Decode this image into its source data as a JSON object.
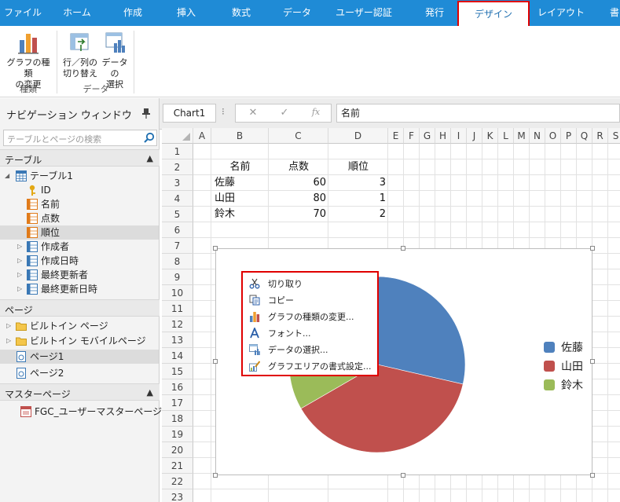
{
  "ribbon": {
    "tabs": [
      {
        "label": "ファイル",
        "active": false
      },
      {
        "label": "ホーム",
        "active": false
      },
      {
        "label": "作成",
        "active": false
      },
      {
        "label": "挿入",
        "active": false
      },
      {
        "label": "数式",
        "active": false
      },
      {
        "label": "データ",
        "active": false
      },
      {
        "label": "ユーザー認証",
        "active": false
      },
      {
        "label": "発行",
        "active": false
      },
      {
        "label": "デザイン",
        "active": true
      },
      {
        "label": "レイアウト",
        "active": false
      },
      {
        "label": "書",
        "active": false
      }
    ],
    "groups": [
      {
        "label": "種類",
        "buttons": [
          {
            "line1": "グラフの種類",
            "line2": "の変更",
            "icon": "chart-type-icon"
          }
        ]
      },
      {
        "label": "データ",
        "buttons": [
          {
            "line1": "行／列の",
            "line2": "切り替え",
            "icon": "switch-row-column-icon"
          },
          {
            "line1": "データの",
            "line2": "選択",
            "icon": "select-data-icon"
          }
        ]
      }
    ],
    "accent": "#1f8bd6",
    "highlight": "#e00000"
  },
  "nav": {
    "title": "ナビゲーション ウィンドウ",
    "search_placeholder": "テーブルとページの検索",
    "sections": {
      "tables": "テーブル",
      "pages": "ページ",
      "master": "マスターページ"
    },
    "table": "テーブル1",
    "fields": [
      "ID",
      "名前",
      "点数",
      "順位",
      "作成者",
      "作成日時",
      "最終更新者",
      "最終更新日時"
    ],
    "pages": [
      "ビルトイン ページ",
      "ビルトイン モバイルページ",
      "ページ1",
      "ページ2"
    ],
    "master_pages": [
      "FGC_ユーザーマスターページ"
    ]
  },
  "formula_bar": {
    "name_box": "Chart1",
    "dots": "⁝",
    "cancel": "✕",
    "confirm": "✓",
    "fx": "fx",
    "content": "名前"
  },
  "grid": {
    "columns": [
      "A",
      "B",
      "C",
      "D",
      "E",
      "F",
      "G",
      "H",
      "I",
      "J",
      "K",
      "L",
      "M",
      "N",
      "O",
      "P",
      "Q",
      "R",
      "S"
    ],
    "rows": [
      "1",
      "2",
      "3",
      "4",
      "5",
      "6",
      "7",
      "8",
      "9",
      "10",
      "11",
      "12",
      "13",
      "14",
      "15",
      "16",
      "17",
      "18",
      "19",
      "20",
      "21",
      "22",
      "23"
    ],
    "headers": [
      "名前",
      "点数",
      "順位"
    ],
    "records": [
      {
        "name": "佐藤",
        "score": "60",
        "rank": "3"
      },
      {
        "name": "山田",
        "score": "80",
        "rank": "1"
      },
      {
        "name": "鈴木",
        "score": "70",
        "rank": "2"
      }
    ]
  },
  "chart_data": {
    "type": "pie",
    "categories": [
      "佐藤",
      "山田",
      "鈴木"
    ],
    "values": [
      60,
      80,
      70
    ],
    "colors": [
      "#4f81bd",
      "#c0504d",
      "#9bbb59"
    ],
    "legend_position": "right"
  },
  "context_menu": [
    {
      "label": "切り取り",
      "icon": "scissors-icon"
    },
    {
      "label": "コピー",
      "icon": "copy-icon"
    },
    {
      "label": "グラフの種類の変更...",
      "icon": "chart-type-icon"
    },
    {
      "label": "フォント...",
      "icon": "font-icon"
    },
    {
      "label": "データの選択...",
      "icon": "select-data-icon"
    },
    {
      "label": "グラフエリアの書式設定...",
      "icon": "format-area-icon"
    }
  ]
}
